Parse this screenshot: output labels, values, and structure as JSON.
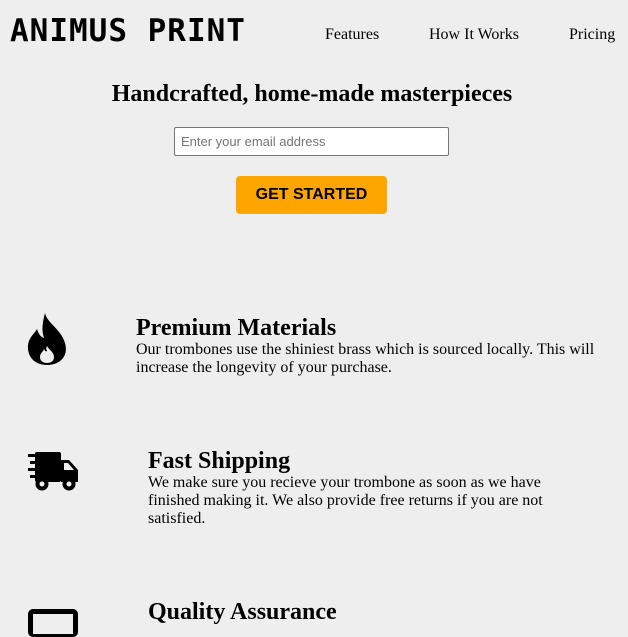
{
  "header": {
    "logo": "ANIMUS PRINT",
    "nav": [
      {
        "label": "Features"
      },
      {
        "label": "How It Works"
      },
      {
        "label": "Pricing"
      }
    ]
  },
  "hero": {
    "title": "Handcrafted, home-made masterpieces",
    "email_placeholder": "Enter your email address",
    "cta_label": "GET STARTED",
    "cta_color": "#ffa500"
  },
  "features": [
    {
      "icon": "fire-icon",
      "title": "Premium Materials",
      "description": "Our trombones use the shiniest brass which is sourced locally. This will increase the longevity of your purchase."
    },
    {
      "icon": "shipping-truck-icon",
      "title": "Fast Shipping",
      "description": "We make sure you recieve your trombone as soon as we have finished making it. We also provide free returns if you are not satisfied."
    },
    {
      "icon": "quality-assurance-icon",
      "title": "Quality Assurance",
      "description": ""
    }
  ]
}
